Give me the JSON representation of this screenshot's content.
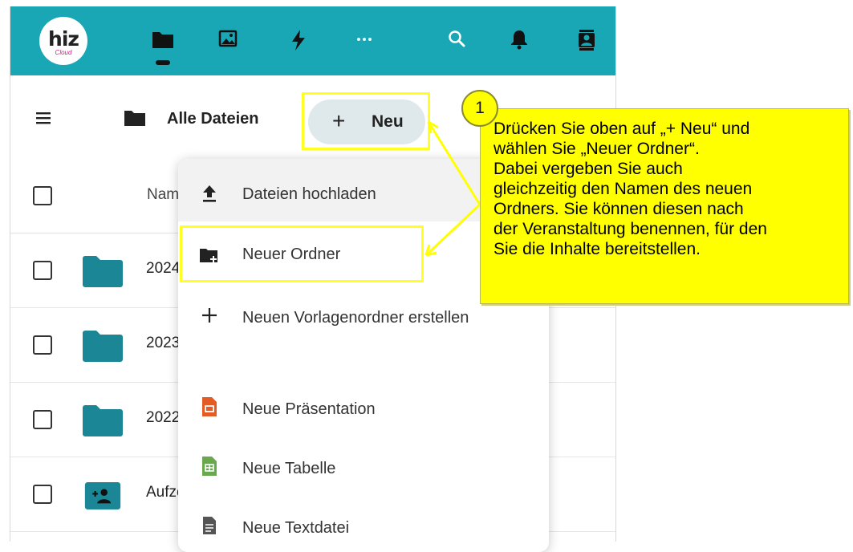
{
  "header": {
    "logo_text": "hiz",
    "logo_subtext": "Cloud",
    "nav_icons": [
      "files-icon",
      "photos-icon",
      "activity-icon",
      "more-icon",
      "search-icon",
      "notifications-icon",
      "contacts-icon"
    ]
  },
  "toolbar": {
    "breadcrumb_label": "Alle Dateien",
    "new_button_plus": "+",
    "new_button_label": "Neu"
  },
  "file_list": {
    "name_column_header": "Name",
    "rows": [
      {
        "name": "2024",
        "icon": "folder-icon"
      },
      {
        "name": "2023",
        "icon": "folder-icon"
      },
      {
        "name": "2022",
        "icon": "folder-icon"
      },
      {
        "name": "Aufzeichnungen",
        "icon": "shared-folder-icon"
      }
    ]
  },
  "new_menu": {
    "items": [
      {
        "label": "Dateien hochladen",
        "icon": "upload-icon"
      },
      {
        "label": "Neuer Ordner",
        "icon": "new-folder-icon"
      },
      {
        "label": "Neuen Vorlagenordner erstellen",
        "icon": "plus-icon"
      },
      {
        "label": "Neue Präsentation",
        "icon": "presentation-icon"
      },
      {
        "label": "Neue Tabelle",
        "icon": "spreadsheet-icon"
      },
      {
        "label": "Neue Textdatei",
        "icon": "text-file-icon"
      }
    ]
  },
  "callout": {
    "step_number": "1",
    "text": "Drücken Sie oben auf „+ Neu“ und\nwählen Sie „Neuer Ordner“.\nDabei vergeben Sie auch\ngleichzeitig den Namen des neuen\nOrdners. Sie können diesen nach\nder Veranstaltung benennen, für den\nSie die Inhalte bereitstellen."
  },
  "colors": {
    "topbar": "#1aa7b5",
    "folder": "#1b8796",
    "highlight": "#ffff00"
  }
}
